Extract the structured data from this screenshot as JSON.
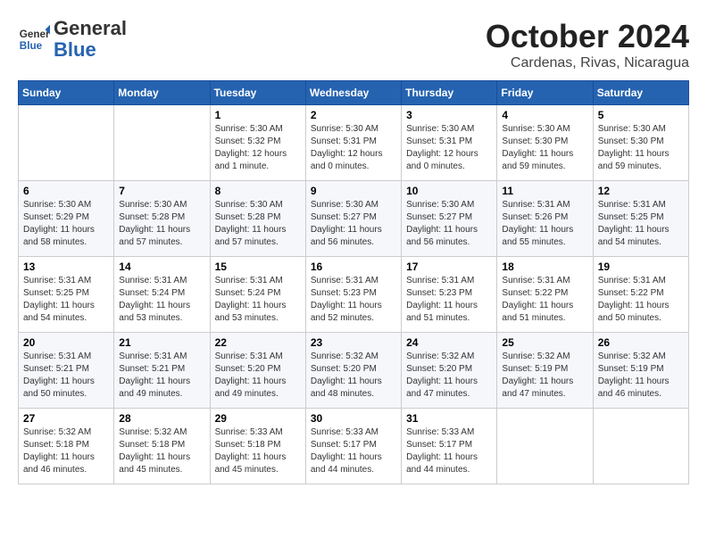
{
  "header": {
    "logo_line1": "General",
    "logo_line2": "Blue",
    "month": "October 2024",
    "location": "Cardenas, Rivas, Nicaragua"
  },
  "weekdays": [
    "Sunday",
    "Monday",
    "Tuesday",
    "Wednesday",
    "Thursday",
    "Friday",
    "Saturday"
  ],
  "weeks": [
    [
      {
        "day": "",
        "info": ""
      },
      {
        "day": "",
        "info": ""
      },
      {
        "day": "1",
        "sunrise": "5:30 AM",
        "sunset": "5:32 PM",
        "daylight": "12 hours and 1 minute."
      },
      {
        "day": "2",
        "sunrise": "5:30 AM",
        "sunset": "5:31 PM",
        "daylight": "12 hours and 0 minutes."
      },
      {
        "day": "3",
        "sunrise": "5:30 AM",
        "sunset": "5:31 PM",
        "daylight": "12 hours and 0 minutes."
      },
      {
        "day": "4",
        "sunrise": "5:30 AM",
        "sunset": "5:30 PM",
        "daylight": "11 hours and 59 minutes."
      },
      {
        "day": "5",
        "sunrise": "5:30 AM",
        "sunset": "5:30 PM",
        "daylight": "11 hours and 59 minutes."
      }
    ],
    [
      {
        "day": "6",
        "sunrise": "5:30 AM",
        "sunset": "5:29 PM",
        "daylight": "11 hours and 58 minutes."
      },
      {
        "day": "7",
        "sunrise": "5:30 AM",
        "sunset": "5:28 PM",
        "daylight": "11 hours and 57 minutes."
      },
      {
        "day": "8",
        "sunrise": "5:30 AM",
        "sunset": "5:28 PM",
        "daylight": "11 hours and 57 minutes."
      },
      {
        "day": "9",
        "sunrise": "5:30 AM",
        "sunset": "5:27 PM",
        "daylight": "11 hours and 56 minutes."
      },
      {
        "day": "10",
        "sunrise": "5:30 AM",
        "sunset": "5:27 PM",
        "daylight": "11 hours and 56 minutes."
      },
      {
        "day": "11",
        "sunrise": "5:31 AM",
        "sunset": "5:26 PM",
        "daylight": "11 hours and 55 minutes."
      },
      {
        "day": "12",
        "sunrise": "5:31 AM",
        "sunset": "5:25 PM",
        "daylight": "11 hours and 54 minutes."
      }
    ],
    [
      {
        "day": "13",
        "sunrise": "5:31 AM",
        "sunset": "5:25 PM",
        "daylight": "11 hours and 54 minutes."
      },
      {
        "day": "14",
        "sunrise": "5:31 AM",
        "sunset": "5:24 PM",
        "daylight": "11 hours and 53 minutes."
      },
      {
        "day": "15",
        "sunrise": "5:31 AM",
        "sunset": "5:24 PM",
        "daylight": "11 hours and 53 minutes."
      },
      {
        "day": "16",
        "sunrise": "5:31 AM",
        "sunset": "5:23 PM",
        "daylight": "11 hours and 52 minutes."
      },
      {
        "day": "17",
        "sunrise": "5:31 AM",
        "sunset": "5:23 PM",
        "daylight": "11 hours and 51 minutes."
      },
      {
        "day": "18",
        "sunrise": "5:31 AM",
        "sunset": "5:22 PM",
        "daylight": "11 hours and 51 minutes."
      },
      {
        "day": "19",
        "sunrise": "5:31 AM",
        "sunset": "5:22 PM",
        "daylight": "11 hours and 50 minutes."
      }
    ],
    [
      {
        "day": "20",
        "sunrise": "5:31 AM",
        "sunset": "5:21 PM",
        "daylight": "11 hours and 50 minutes."
      },
      {
        "day": "21",
        "sunrise": "5:31 AM",
        "sunset": "5:21 PM",
        "daylight": "11 hours and 49 minutes."
      },
      {
        "day": "22",
        "sunrise": "5:31 AM",
        "sunset": "5:20 PM",
        "daylight": "11 hours and 49 minutes."
      },
      {
        "day": "23",
        "sunrise": "5:32 AM",
        "sunset": "5:20 PM",
        "daylight": "11 hours and 48 minutes."
      },
      {
        "day": "24",
        "sunrise": "5:32 AM",
        "sunset": "5:20 PM",
        "daylight": "11 hours and 47 minutes."
      },
      {
        "day": "25",
        "sunrise": "5:32 AM",
        "sunset": "5:19 PM",
        "daylight": "11 hours and 47 minutes."
      },
      {
        "day": "26",
        "sunrise": "5:32 AM",
        "sunset": "5:19 PM",
        "daylight": "11 hours and 46 minutes."
      }
    ],
    [
      {
        "day": "27",
        "sunrise": "5:32 AM",
        "sunset": "5:18 PM",
        "daylight": "11 hours and 46 minutes."
      },
      {
        "day": "28",
        "sunrise": "5:32 AM",
        "sunset": "5:18 PM",
        "daylight": "11 hours and 45 minutes."
      },
      {
        "day": "29",
        "sunrise": "5:33 AM",
        "sunset": "5:18 PM",
        "daylight": "11 hours and 45 minutes."
      },
      {
        "day": "30",
        "sunrise": "5:33 AM",
        "sunset": "5:17 PM",
        "daylight": "11 hours and 44 minutes."
      },
      {
        "day": "31",
        "sunrise": "5:33 AM",
        "sunset": "5:17 PM",
        "daylight": "11 hours and 44 minutes."
      },
      {
        "day": "",
        "info": ""
      },
      {
        "day": "",
        "info": ""
      }
    ]
  ]
}
